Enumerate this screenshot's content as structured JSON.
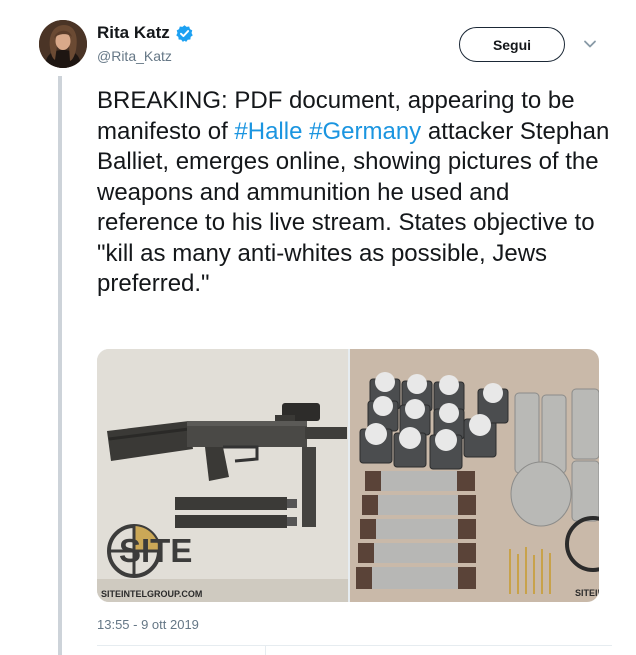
{
  "author": {
    "display_name": "Rita Katz",
    "handle": "@Rita_Katz",
    "verified": true
  },
  "follow_button_label": "Segui",
  "tweet": {
    "text_parts": [
      "BREAKING: PDF document, appearing to be manifesto of ",
      "#Halle",
      " ",
      "#Germany",
      " attacker Stephan Balliet, emerges online, showing pictures of the weapons and ammunition he used and reference to his live stream. States objective to \"kill as many anti-whites as possible, Jews preferred.\""
    ]
  },
  "media": {
    "left_watermark": "SITE",
    "left_caption": "SITEINTELGROUP.COM",
    "right_watermark": "SITEIN"
  },
  "timestamp": "13:55 - 9 ott 2019",
  "colors": {
    "link": "#1b95e0",
    "verified": "#1da1f2",
    "secondary_text": "#657786"
  },
  "icons": [
    "verified-badge-icon",
    "chevron-down-icon"
  ]
}
